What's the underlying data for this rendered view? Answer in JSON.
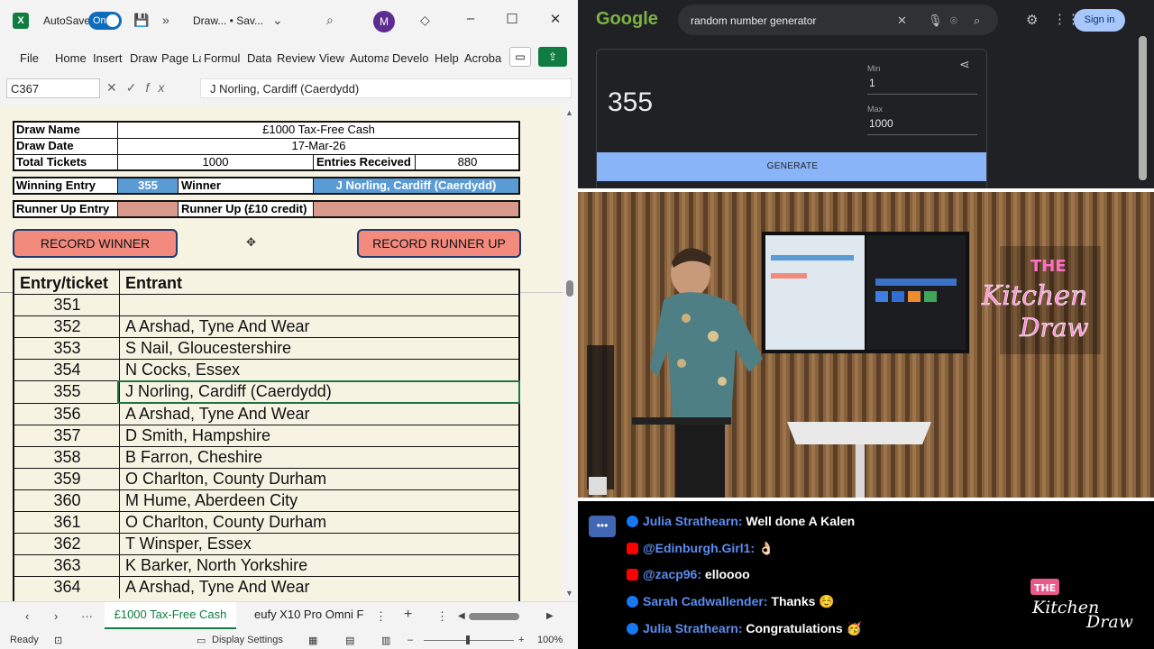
{
  "excel": {
    "autosave_label": "AutoSave",
    "autosave_state": "On",
    "doc_title": "Draw...  •  Sav...",
    "avatar_initial": "M",
    "ribbon_tabs": [
      "File",
      "Home",
      "Insert",
      "Draw",
      "Page La",
      "Formul",
      "Data",
      "Review",
      "View",
      "Automa",
      "Develo",
      "Help",
      "Acroba"
    ],
    "name_box": "C367",
    "formula_value": "J Norling, Cardiff (Caerdydd)",
    "draw": {
      "draw_name_label": "Draw Name",
      "draw_name_value": "£1000 Tax-Free Cash",
      "draw_date_label": "Draw Date",
      "draw_date_value": "17-Mar-26",
      "total_tickets_label": "Total Tickets",
      "total_tickets_value": "1000",
      "entries_received_label": "Entries Received",
      "entries_received_value": "880",
      "winning_entry_label": "Winning Entry",
      "winning_entry_value": "355",
      "winner_label": "Winner",
      "winner_value": "J Norling, Cardiff (Caerdydd)",
      "runner_up_entry_label": "Runner Up Entry",
      "runner_up_label": "Runner Up (£10 credit)"
    },
    "buttons": {
      "record_winner": "RECORD WINNER",
      "record_runner_up": "RECORD RUNNER UP"
    },
    "table": {
      "col_entry": "Entry/ticket",
      "col_entrant": "Entrant",
      "rows": [
        {
          "entry": "351",
          "entrant": ""
        },
        {
          "entry": "352",
          "entrant": "A Arshad, Tyne And Wear"
        },
        {
          "entry": "353",
          "entrant": "S Nail, Gloucestershire"
        },
        {
          "entry": "354",
          "entrant": "N Cocks, Essex"
        },
        {
          "entry": "355",
          "entrant": "J Norling, Cardiff (Caerdydd)"
        },
        {
          "entry": "356",
          "entrant": "A Arshad, Tyne And Wear"
        },
        {
          "entry": "357",
          "entrant": "D Smith, Hampshire"
        },
        {
          "entry": "358",
          "entrant": "B Farron, Cheshire"
        },
        {
          "entry": "359",
          "entrant": "O Charlton, County Durham"
        },
        {
          "entry": "360",
          "entrant": "M Hume, Aberdeen City"
        },
        {
          "entry": "361",
          "entrant": "O Charlton, County Durham"
        },
        {
          "entry": "362",
          "entrant": "T Winsper, Essex"
        },
        {
          "entry": "363",
          "entrant": "K Barker, North Yorkshire"
        },
        {
          "entry": "364",
          "entrant": "A Arshad, Tyne And Wear"
        }
      ]
    },
    "sheet_tabs": {
      "active": "£1000 Tax-Free Cash",
      "other": "eufy X10 Pro Omni F"
    },
    "status": {
      "ready": "Ready",
      "display_settings": "Display Settings",
      "zoom": "100%"
    },
    "colors": {
      "winner_fill": "#5b9bd5",
      "runner_up_fill": "#d99a8b",
      "button_fill": "#f28b7e",
      "excel_green": "#107c41"
    }
  },
  "google": {
    "logo_text": "Google",
    "query": "random number generator",
    "sign_in": "Sign in",
    "result": "355",
    "min_label": "Min",
    "min_value": "1",
    "max_label": "Max",
    "max_value": "1000",
    "generate": "GENERATE"
  },
  "video": {
    "neon_the": "THE",
    "neon_kitchen": "Kitchen",
    "neon_draw": "Draw"
  },
  "chat": {
    "messages": [
      {
        "source": "facebook",
        "user": "Julia Strathearn:",
        "text": "Well done A Kalen"
      },
      {
        "source": "youtube",
        "user": "@Edinburgh.Girl1:",
        "text": "👌🏻"
      },
      {
        "source": "youtube",
        "user": "@zacp96:",
        "text": "elloooo"
      },
      {
        "source": "facebook",
        "user": "Sarah Cadwallender:",
        "text": "Thanks ☺️"
      },
      {
        "source": "facebook",
        "user": "Julia Strathearn:",
        "text": "Congratulations 🥳"
      }
    ],
    "logo_the": "THE",
    "logo_kitchen": "Kitchen",
    "logo_draw": "Draw"
  }
}
